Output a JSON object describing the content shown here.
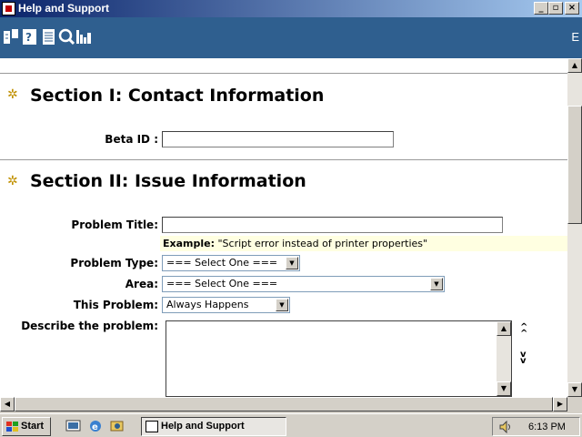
{
  "window": {
    "title": "Help and Support",
    "buttons": [
      "_",
      "▫",
      "×"
    ]
  },
  "toolbar": {
    "icons": [
      "index-icon",
      "help-icon",
      "document-icon",
      "search-icon",
      "chart-icon"
    ],
    "right_label": "E"
  },
  "sections": [
    {
      "title": "Section I: Contact Information"
    },
    {
      "title": "Section II: Issue Information"
    }
  ],
  "form": {
    "beta_id_label": "Beta ID :",
    "problem_title_label": "Problem Title:",
    "example_prefix": "Example:",
    "example_text": "\"Script error instead of printer properties\"",
    "problem_type_label": "Problem Type:",
    "problem_type_value": "=== Select One ===",
    "area_label": "Area:",
    "area_value": "=== Select One ===",
    "this_problem_label": "This Problem:",
    "this_problem_value": "Always Happens",
    "describe_label": "Describe the problem:",
    "up_glyph": "^\n^",
    "down_glyph": "v\nv"
  },
  "taskbar": {
    "start_label": "Start",
    "task_label": "Help and Support",
    "clock": "6:13 PM"
  }
}
